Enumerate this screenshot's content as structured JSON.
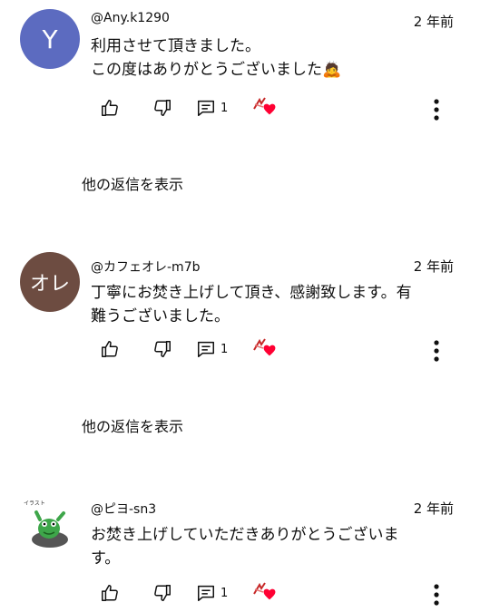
{
  "comments": [
    {
      "avatar_letter": "Y",
      "avatar_color": "#5c6bc0",
      "author": "@Any.k1290",
      "time": "2 年前",
      "text": "利用させて頂きました。\nこの度はありがとうございました🙇",
      "reply_count": "1"
    },
    {
      "avatar_letter": "オレ",
      "avatar_color": "#6d4c41",
      "author": "@カフェオレ-m7b",
      "time": "2 年前",
      "text": "丁寧にお焚き上げして頂き、感謝致します。有\n難うございました。",
      "reply_count": "1"
    },
    {
      "avatar_letter": "",
      "avatar_color": "#ffffff",
      "author": "@ピヨ-sn3",
      "time": "2 年前",
      "text": "お焚き上げしていただきありがとうございま\nす。",
      "reply_count": "1"
    }
  ],
  "show_replies_label": "他の返信を表示",
  "colors": {
    "heart": "#ff0033",
    "icon": "#0f0f0f"
  },
  "icons": [
    "like-icon",
    "dislike-icon",
    "reply-icon",
    "creator-heart-icon",
    "more-vert-icon"
  ]
}
